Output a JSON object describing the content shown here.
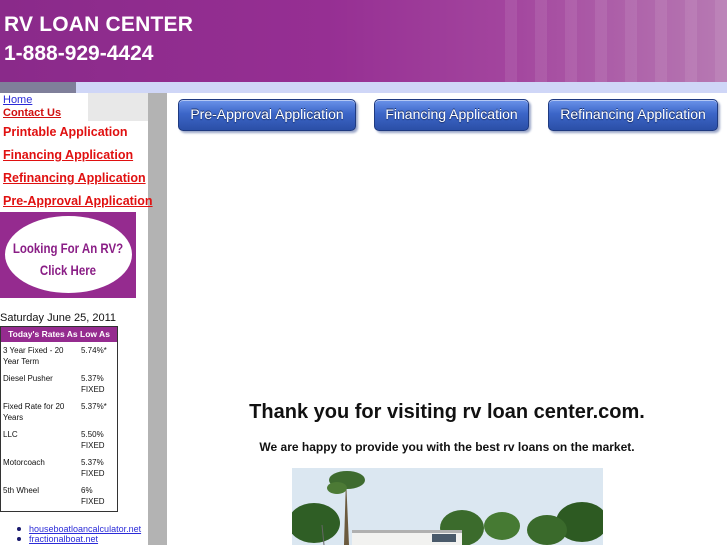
{
  "header": {
    "title": "RV LOAN CENTER",
    "phone": "1-888-929-4424"
  },
  "nav": {
    "home": "Home",
    "contact": "Contact Us"
  },
  "sidebar_links": [
    "Printable Application",
    "Financing Application",
    "Refinancing Application",
    "Pre-Approval Application"
  ],
  "rv_banner": {
    "line1": "Looking For An RV?",
    "line2": "Click Here"
  },
  "date": "Saturday June 25, 2011",
  "rates": {
    "title": "Today's Rates As Low As",
    "rows": [
      {
        "name": "3 Year Fixed - 20 Year Term",
        "value": "5.74%*"
      },
      {
        "name": "Diesel Pusher",
        "value": "5.37% FIXED"
      },
      {
        "name": "Fixed Rate for 20 Years",
        "value": "5.37%*"
      },
      {
        "name": "LLC",
        "value": "5.50% FIXED"
      },
      {
        "name": "Motorcoach",
        "value": "5.37% FIXED"
      },
      {
        "name": "5th Wheel",
        "value": "6% FIXED"
      }
    ]
  },
  "footer_links": [
    "houseboatloancalculator.net",
    "fractionalboat.net"
  ],
  "buttons": {
    "preapproval": "Pre-Approval Application",
    "financing": "Financing Application",
    "refinancing": "Refinancing Application"
  },
  "main": {
    "thanks": "Thank you for visiting rv loan center.com.",
    "happy": "We are happy to provide you with the best rv loans on the market."
  },
  "colors": {
    "brand_purple": "#952b8f",
    "link_red": "#e01010",
    "link_blue": "#2b2bd8",
    "button_blue": "#3c66c8"
  }
}
